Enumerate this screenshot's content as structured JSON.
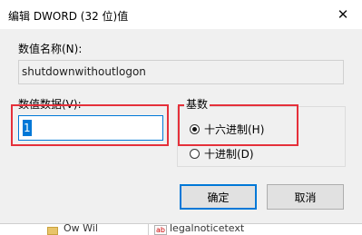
{
  "window": {
    "title": "编辑 DWORD (32 位)值",
    "close_glyph": "✕"
  },
  "name_label": "数值名称(N):",
  "name_value": "shutdownwithoutlogon",
  "data_label": "数值数据(V):",
  "data_value": "1",
  "base": {
    "label": "基数",
    "hex_label": "十六进制(H)",
    "dec_label": "十进制(D)",
    "selected": "hex"
  },
  "buttons": {
    "ok": "确定",
    "cancel": "取消"
  },
  "background": {
    "tree_item": "Ow Wil",
    "list_icon_label": "ab",
    "list_item": "legalnoticetext"
  },
  "colors": {
    "accent": "#0078d7",
    "highlight": "#e5303a"
  }
}
